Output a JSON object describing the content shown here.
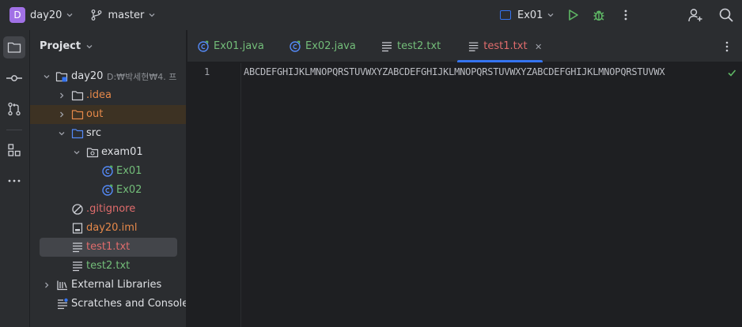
{
  "titlebar": {
    "project_badge": "D",
    "project_name": "day20",
    "branch": "master",
    "run_config": "Ex01",
    "icons": [
      "branch-icon",
      "run-icon",
      "debug-icon",
      "more-vertical-icon",
      "add-user-icon",
      "search-icon"
    ],
    "colors": {
      "badge": "#a171e6",
      "run": "#5fb865",
      "accent": "#3574f0"
    }
  },
  "toolstrip": {
    "items": [
      "project-folder-icon",
      "commit-icon",
      "pull-requests-icon",
      "structure-icon",
      "more-horizontal-icon"
    ]
  },
  "project_panel": {
    "title": "Project",
    "tree": [
      {
        "label": "day20",
        "hint": "D:₩박세현₩4. 프",
        "type": "module"
      },
      {
        "label": ".idea",
        "type": "folder"
      },
      {
        "label": "out",
        "type": "folder"
      },
      {
        "label": "src",
        "type": "folder"
      },
      {
        "label": "exam01",
        "type": "package"
      },
      {
        "label": "Ex01",
        "type": "java"
      },
      {
        "label": "Ex02",
        "type": "java"
      },
      {
        "label": ".gitignore",
        "type": "ignore"
      },
      {
        "label": "day20.iml",
        "type": "iml"
      },
      {
        "label": "test1.txt",
        "type": "text"
      },
      {
        "label": "test2.txt",
        "type": "text"
      },
      {
        "label": "External Libraries",
        "type": "libraries"
      },
      {
        "label": "Scratches and Consoles",
        "type": "scratches"
      }
    ]
  },
  "tabs": [
    {
      "label": "Ex01.java",
      "type": "java"
    },
    {
      "label": "Ex02.java",
      "type": "java"
    },
    {
      "label": "test2.txt",
      "type": "text"
    },
    {
      "label": "test1.txt",
      "type": "text",
      "active": true
    }
  ],
  "editor": {
    "line_number": "1",
    "line_text": "ABCDEFGHIJKLMNOPQRSTUVWXYZABCDEFGHIJKLMNOPQRSTUVWXYZABCDEFGHIJKLMNOPQRSTUVWX"
  }
}
